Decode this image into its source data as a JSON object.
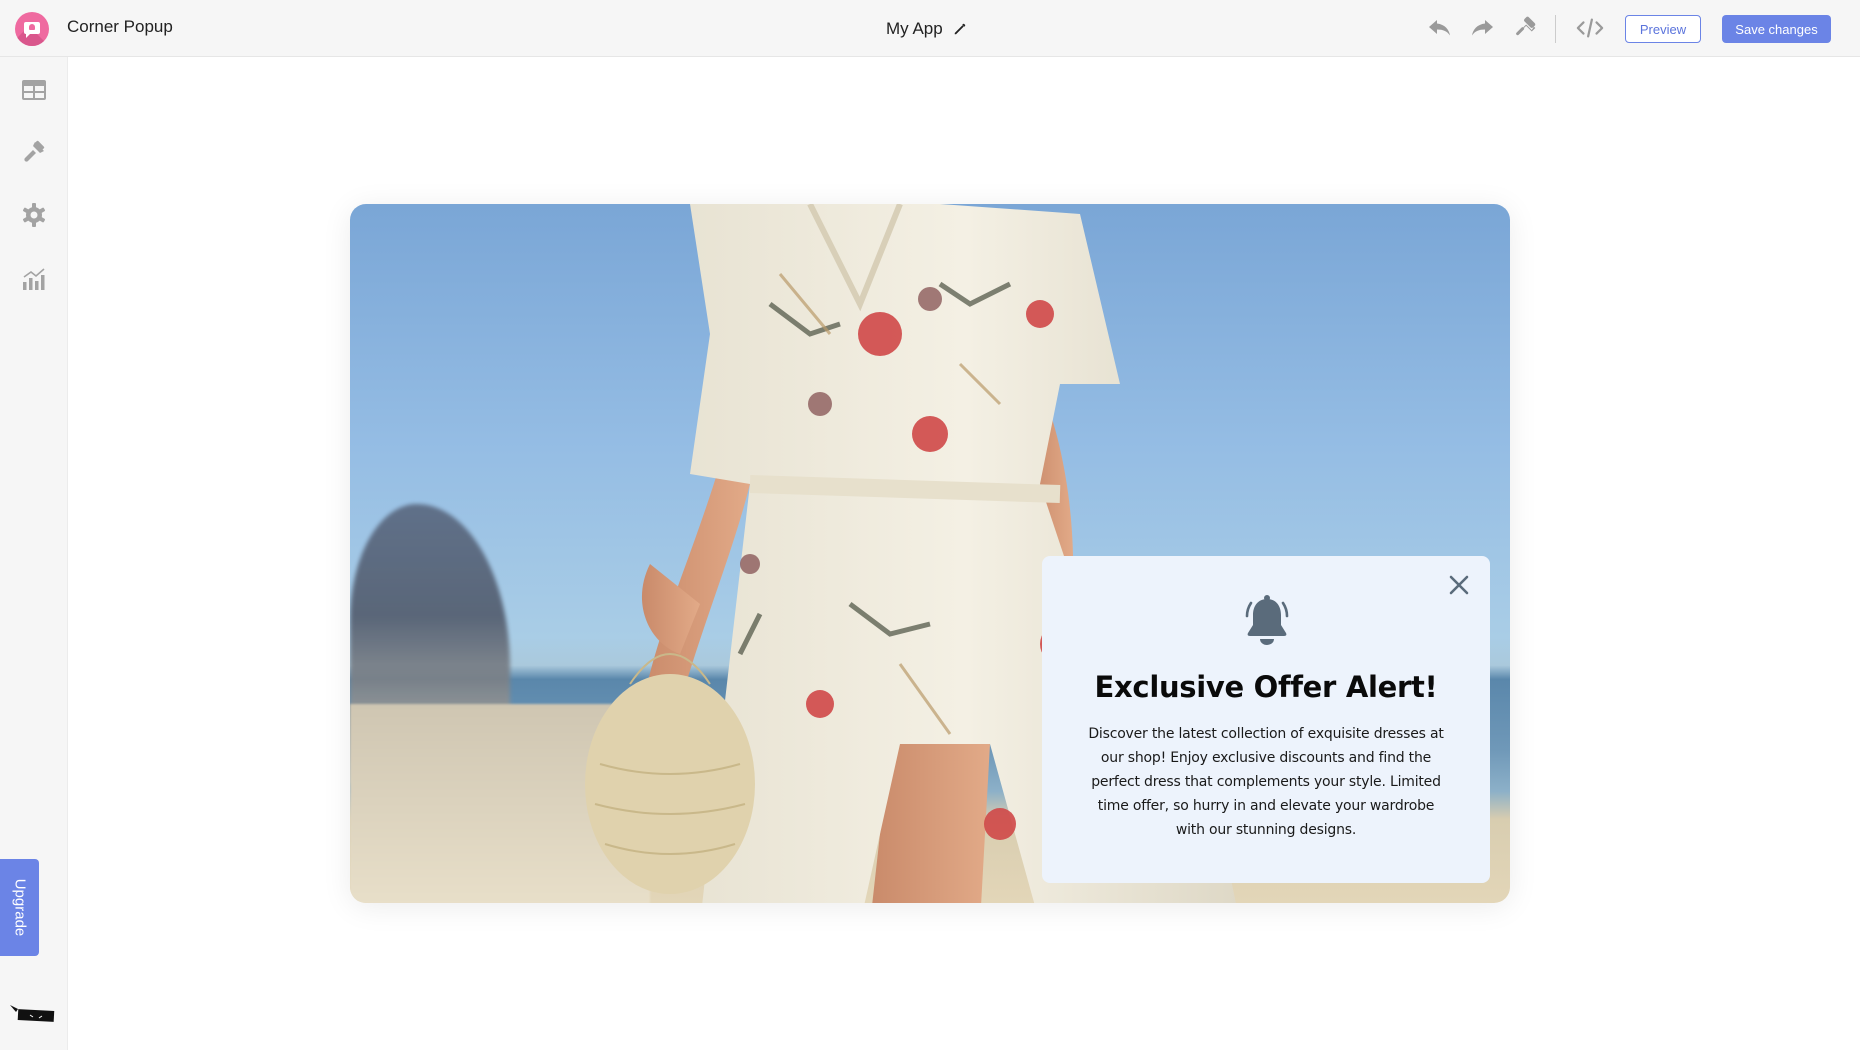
{
  "header": {
    "app_name": "Corner Popup",
    "project_title": "My App",
    "preview_label": "Preview",
    "save_label": "Save changes",
    "tools": [
      "undo-icon",
      "redo-icon",
      "paint-roller-icon",
      "code-icon"
    ]
  },
  "sidebar": {
    "items": [
      {
        "name": "layout",
        "icon": "layout-grid-icon"
      },
      {
        "name": "style",
        "icon": "paintbrush-icon"
      },
      {
        "name": "settings",
        "icon": "gear-icon"
      },
      {
        "name": "analytics",
        "icon": "analytics-chart-icon"
      }
    ],
    "upgrade_label": "Upgrade"
  },
  "popup": {
    "icon": "bell-icon",
    "title": "Exclusive Offer Alert!",
    "body": "Discover the latest collection of exquisite dresses at our shop! Enjoy exclusive discounts and find the perfect dress that complements your style. Limited time offer, so hurry in and elevate your wardrobe with our stunning designs."
  },
  "colors": {
    "accent": "#6b84e6",
    "logo": "#ef6aa0",
    "popup_bg": "#edf3fc",
    "icon_gray": "#9a9a9a",
    "bell": "#5a6b7b"
  }
}
